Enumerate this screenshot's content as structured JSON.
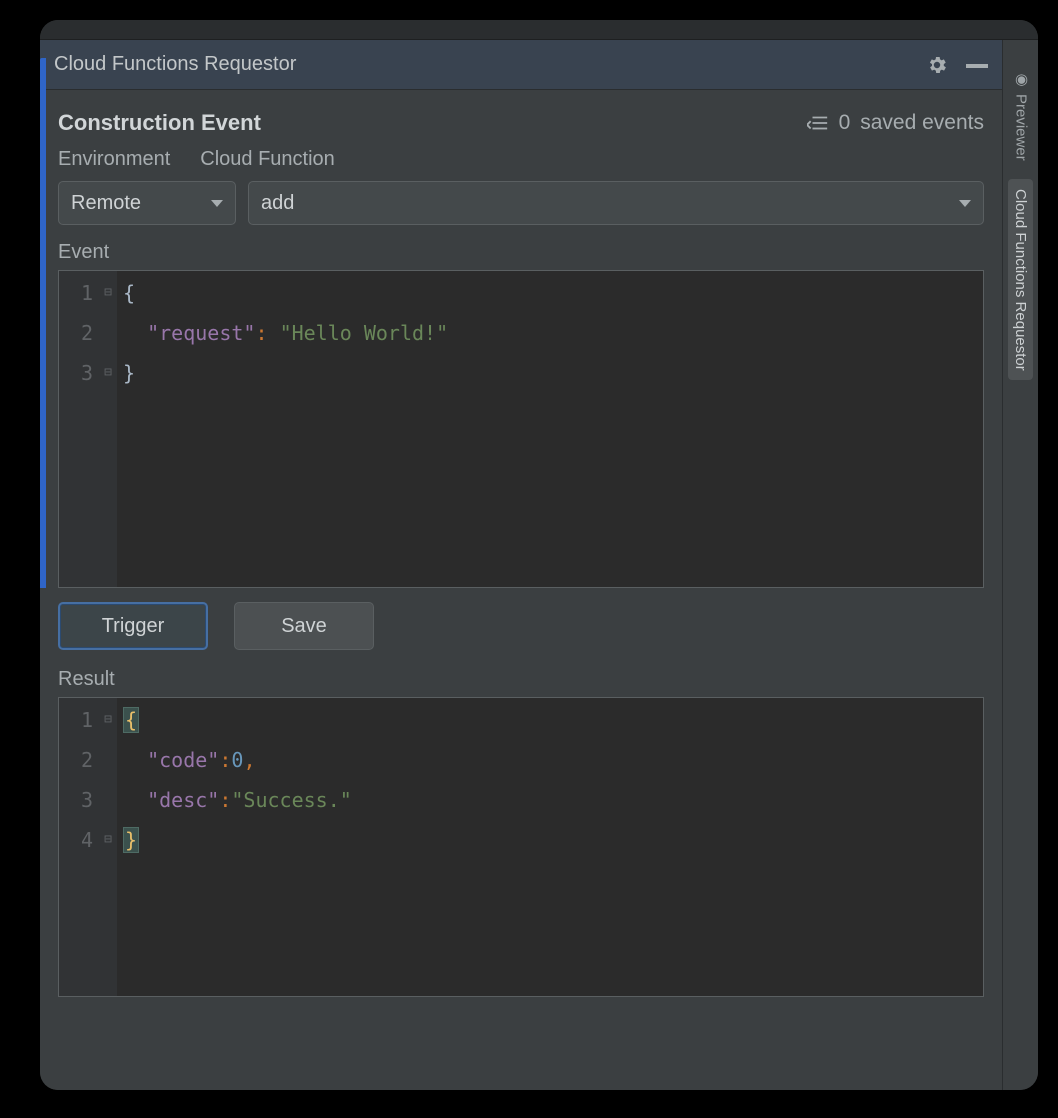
{
  "panel": {
    "title": "Cloud Functions Requestor"
  },
  "section": {
    "title": "Construction Event",
    "saved_events_count": "0",
    "saved_events_label": "saved events"
  },
  "labels": {
    "environment": "Environment",
    "cloud_function": "Cloud Function",
    "event": "Event",
    "result": "Result"
  },
  "selects": {
    "environment_value": "Remote",
    "function_value": "add"
  },
  "event_code": {
    "lines": [
      "1",
      "2",
      "3"
    ],
    "key1": "\"request\"",
    "val1": "\"Hello World!\""
  },
  "buttons": {
    "trigger": "Trigger",
    "save": "Save"
  },
  "result_code": {
    "lines": [
      "1",
      "2",
      "3",
      "4"
    ],
    "key1": "\"code\"",
    "val1": "0",
    "key2": "\"desc\"",
    "val2": "\"Success.\""
  },
  "right_tabs": {
    "previewer": "Previewer",
    "requestor": "Cloud Functions Requestor"
  }
}
